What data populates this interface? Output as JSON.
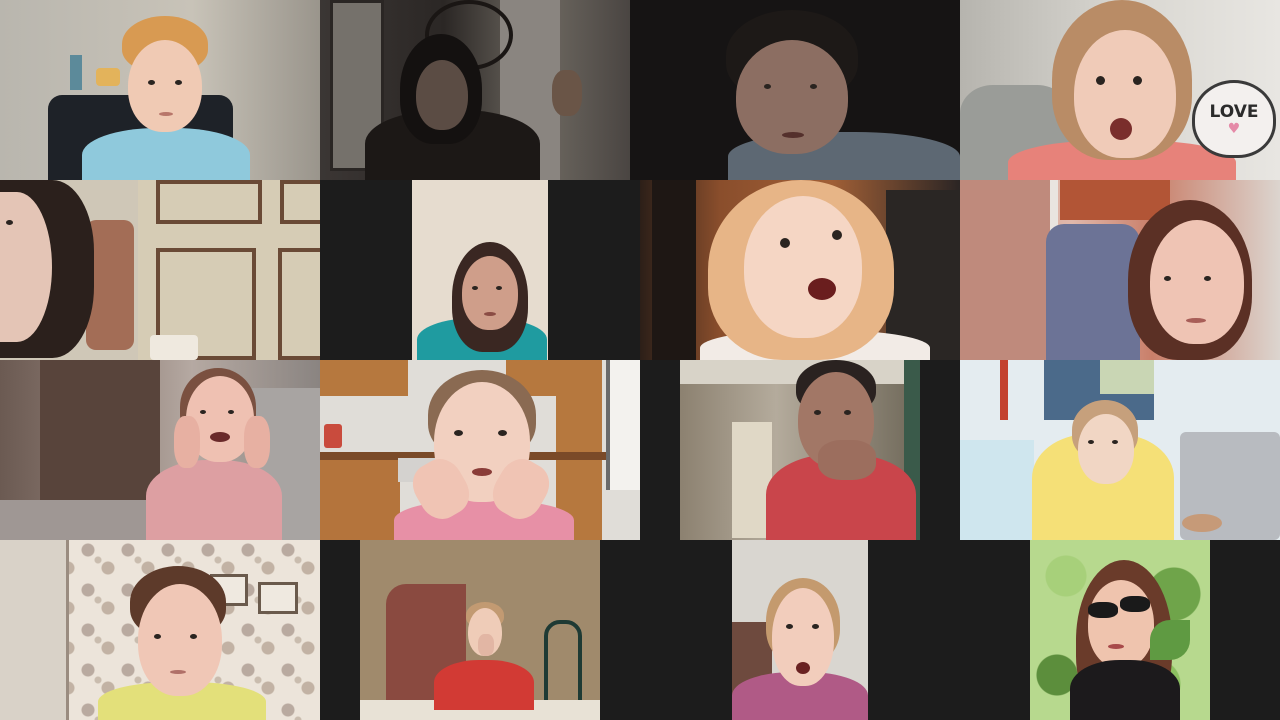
{
  "meeting": {
    "view_mode": "gallery",
    "rows": 4,
    "participant_count": 15
  },
  "participants": [
    {
      "row": 0,
      "description_icon": "participant-video-tile",
      "sign_text": ""
    },
    {
      "row": 0,
      "description_icon": "participant-video-tile",
      "sign_text": ""
    },
    {
      "row": 0,
      "description_icon": "participant-video-tile",
      "sign_text": ""
    },
    {
      "row": 0,
      "description_icon": "participant-video-tile",
      "sign_text": "LOVE"
    },
    {
      "row": 1,
      "description_icon": "participant-video-tile",
      "sign_text": ""
    },
    {
      "row": 1,
      "description_icon": "participant-video-tile",
      "sign_text": ""
    },
    {
      "row": 1,
      "description_icon": "participant-video-tile",
      "sign_text": ""
    },
    {
      "row": 1,
      "description_icon": "participant-video-tile",
      "sign_text": ""
    },
    {
      "row": 2,
      "description_icon": "participant-video-tile",
      "sign_text": ""
    },
    {
      "row": 2,
      "description_icon": "participant-video-tile",
      "sign_text": ""
    },
    {
      "row": 2,
      "description_icon": "participant-video-tile",
      "sign_text": ""
    },
    {
      "row": 2,
      "description_icon": "participant-video-tile",
      "sign_text": ""
    },
    {
      "row": 3,
      "description_icon": "participant-video-tile",
      "sign_text": ""
    },
    {
      "row": 3,
      "description_icon": "participant-video-tile",
      "sign_text": ""
    },
    {
      "row": 3,
      "description_icon": "participant-video-tile",
      "sign_text": ""
    },
    {
      "row": 3,
      "description_icon": "participant-video-tile",
      "sign_text": ""
    }
  ],
  "colors": {
    "background": "#1c1c1c",
    "tile_gap": "#1c1c1c"
  }
}
